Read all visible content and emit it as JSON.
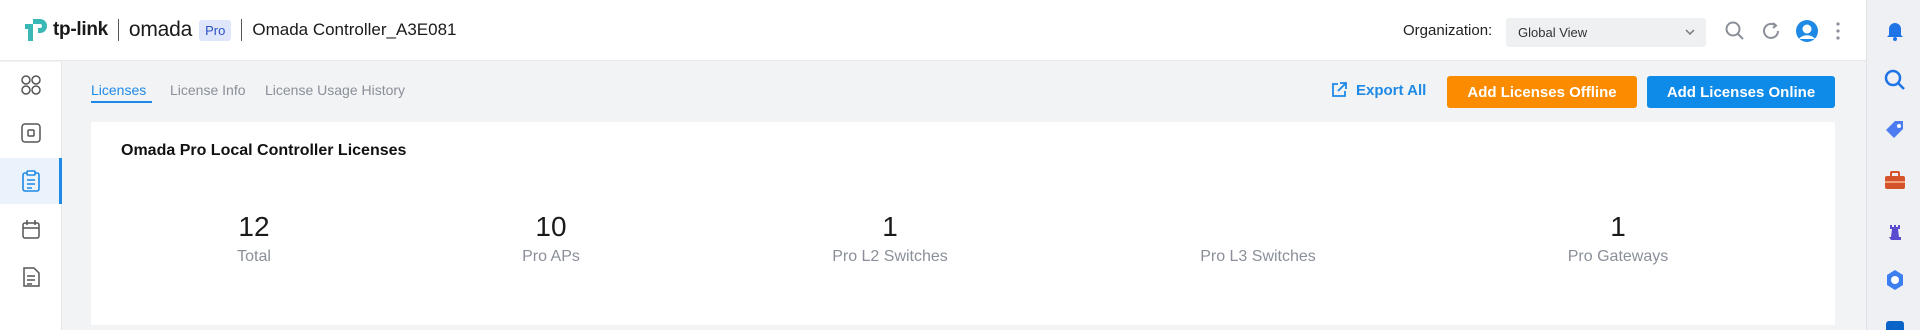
{
  "header": {
    "brand": "tp-link",
    "product": "omada",
    "badge": "Pro",
    "controller_name": "Omada Controller_A3E081",
    "org_label": "Organization:",
    "org_value": "Global View"
  },
  "tabs": [
    {
      "label": "Licenses",
      "active": true
    },
    {
      "label": "License Info",
      "active": false
    },
    {
      "label": "License Usage History",
      "active": false
    }
  ],
  "actions": {
    "export_label": "Export All",
    "add_offline_label": "Add Licenses Offline",
    "add_online_label": "Add Licenses Online"
  },
  "card": {
    "title": "Omada Pro Local Controller Licenses",
    "stats": [
      {
        "value": "12",
        "label": "Total"
      },
      {
        "value": "10",
        "label": "Pro APs"
      },
      {
        "value": "1",
        "label": "Pro L2 Switches"
      },
      {
        "value": "",
        "label": "Pro L3 Switches"
      },
      {
        "value": "1",
        "label": "Pro Gateways"
      }
    ]
  },
  "nav_icons": [
    "dashboard-icon",
    "devices-icon",
    "licenses-icon",
    "calendar-icon",
    "logs-icon"
  ],
  "system_icons": [
    "notification-bell-icon",
    "search-icon",
    "tag-icon",
    "toolbox-icon",
    "chess-icon",
    "copilot-icon",
    "outlook-icon"
  ],
  "colors": {
    "accent": "#1e8ae6",
    "orange": "#fb8c00",
    "blue": "#0e8ae8"
  }
}
